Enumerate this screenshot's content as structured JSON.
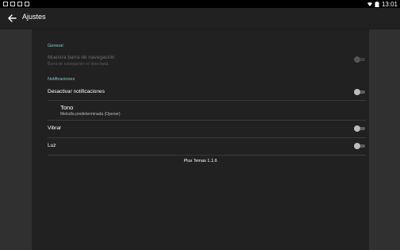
{
  "status_bar": {
    "time": "13:01",
    "left_icons": [
      "image-icon",
      "photo-icon",
      "gallery-icon",
      "camera-icon"
    ],
    "right_icons": [
      "wifi-icon",
      "battery-icon"
    ]
  },
  "app_bar": {
    "title": "Ajustes",
    "back_icon": "arrow-back-icon"
  },
  "settings": {
    "general": {
      "header": "General",
      "nav_bar": {
        "title": "Muestra barra de navegación",
        "summary": "Barra de navegación no detectada",
        "enabled": false,
        "checked": false
      }
    },
    "notifications": {
      "header": "Notificaciones",
      "disable": {
        "title": "Desactivar notificaciones",
        "checked": false
      },
      "tone": {
        "title": "Tono",
        "summary": "Melodía predeterminada (Opener)"
      },
      "vibrate": {
        "title": "Vibrar",
        "checked": false
      },
      "light": {
        "title": "Luz",
        "checked": false
      }
    },
    "footer": "Plus Temas 1.1.6"
  },
  "colors": {
    "accent": "#80cbc4",
    "background": "#303030",
    "surface": "#212121"
  }
}
